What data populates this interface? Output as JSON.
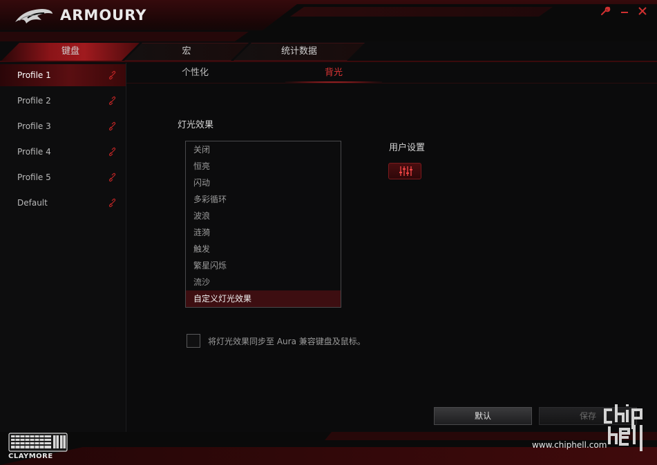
{
  "app": {
    "brand": "ARMOURY"
  },
  "window_controls": [
    {
      "name": "settings-wrench-icon",
      "glyph": "🔧"
    },
    {
      "name": "minimize-icon",
      "glyph": "–"
    },
    {
      "name": "close-icon",
      "glyph": "✕"
    }
  ],
  "top_tabs": [
    {
      "label": "键盘",
      "active": true
    },
    {
      "label": "宏",
      "active": false
    },
    {
      "label": "统计数据",
      "active": false
    }
  ],
  "profiles": [
    {
      "label": "Profile 1",
      "active": true
    },
    {
      "label": "Profile 2",
      "active": false
    },
    {
      "label": "Profile 3",
      "active": false
    },
    {
      "label": "Profile 4",
      "active": false
    },
    {
      "label": "Profile 5",
      "active": false
    },
    {
      "label": "Default",
      "active": false
    }
  ],
  "sub_tabs": [
    {
      "label": "个性化",
      "active": false
    },
    {
      "label": "背光",
      "active": true
    }
  ],
  "lighting": {
    "title": "灯光效果",
    "effects": [
      "关闭",
      "恒亮",
      "闪动",
      "多彩循环",
      "波浪",
      "涟漪",
      "触发",
      "繁星闪烁",
      "流沙",
      "自定义灯光效果"
    ],
    "selected": "自定义灯光效果"
  },
  "user_settings": {
    "label": "用户设置"
  },
  "sync": {
    "label": "将灯光效果同步至 Aura 兼容键盘及鼠标。",
    "checked": false
  },
  "buttons": {
    "default": "默认",
    "save": "保存"
  },
  "footer": {
    "keyboard_name": "CLAYMORE",
    "watermark_url": "www.chiphell.com"
  },
  "colors": {
    "accent": "#c02525",
    "selected_row": "#3d0e11",
    "background": "#0b0b0c"
  }
}
